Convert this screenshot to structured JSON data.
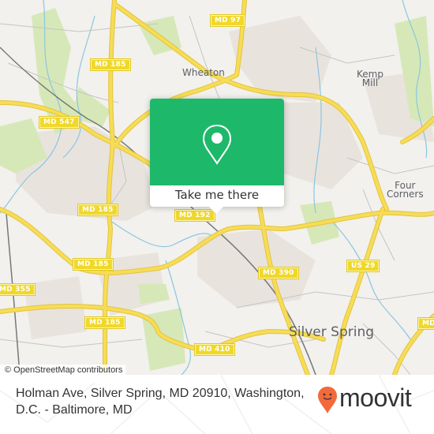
{
  "map": {
    "attribution": "© OpenStreetMap contributors",
    "places": [
      {
        "name": "Wheaton",
        "size": "small"
      },
      {
        "name": "Kemp\nMill",
        "size": "small"
      },
      {
        "name": "Four\nCorners",
        "size": "small"
      },
      {
        "name": "Silver Spring",
        "size": "big"
      }
    ],
    "road_shields": [
      "MD 97",
      "MD 185",
      "MD 547",
      "MD 185",
      "MD 192",
      "MD 185",
      "MD 355",
      "MD 185",
      "MD 390",
      "US 29",
      "MD 410",
      "MD"
    ],
    "colors": {
      "land": "#f2f1ed",
      "park": "#d6e8b8",
      "urban": "#e9e3de",
      "road": "#f5d94a",
      "water": "#8cc6e0",
      "rail": "#777777",
      "minor_road": "#c4c4c4"
    }
  },
  "popup": {
    "button_label": "Take me there",
    "icon": "location-pin-icon",
    "color": "#1eb86a"
  },
  "footer": {
    "address": "Holman Ave, Silver Spring, MD 20910, Washington, D.C. - Baltimore, MD",
    "brand": "moovit",
    "brand_color": "#f26a3b"
  }
}
